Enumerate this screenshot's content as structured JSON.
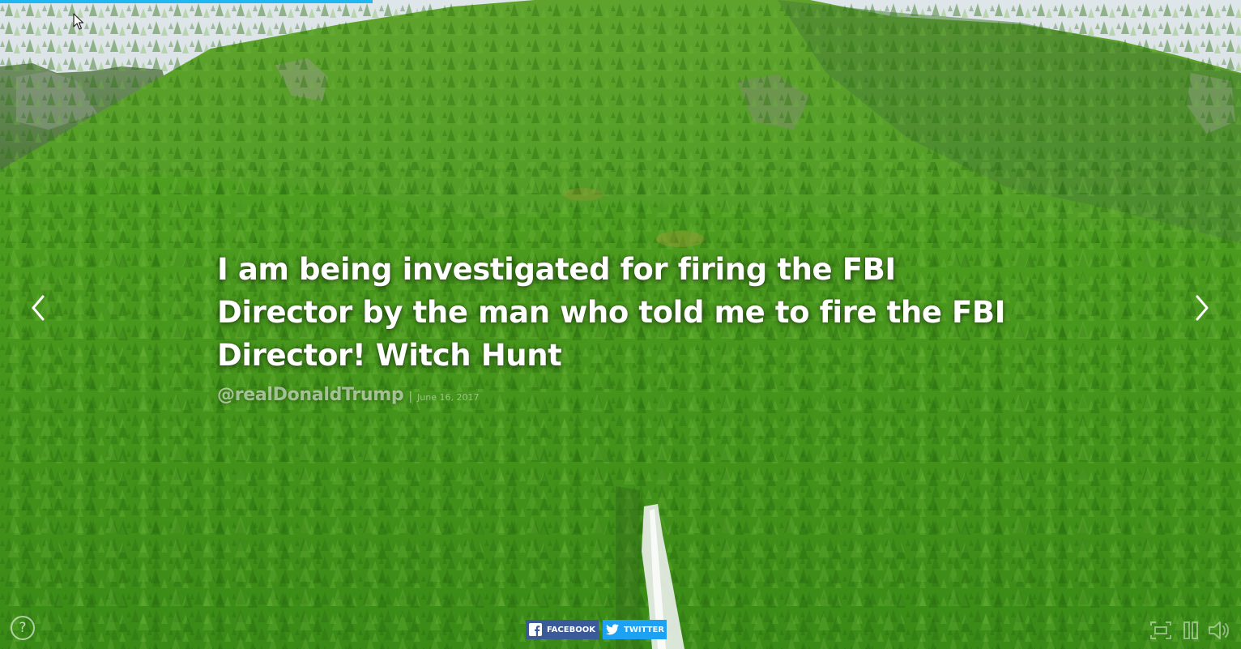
{
  "slide": {
    "quote": "I am being investigated for firing the FBI Director by the man who told me to fire the FBI Director! Witch Hunt",
    "handle": "@realDonaldTrump",
    "separator": "|",
    "date": "June 16, 2017"
  },
  "progress": {
    "fraction": 0.3
  },
  "share": {
    "facebook_label": "FACEBOOK",
    "twitter_label": "TWITTER"
  },
  "help": {
    "label": "?"
  },
  "icons": {
    "prev": "chevron-left-icon",
    "next": "chevron-right-icon",
    "help": "question-circle-icon",
    "facebook": "facebook-icon",
    "twitter": "twitter-icon",
    "fullscreen": "fullscreen-icon",
    "pause": "pause-icon",
    "volume": "volume-icon"
  },
  "colors": {
    "progress": "#1fb8f2",
    "facebook": "#3b5a98",
    "twitter": "#1da1f2",
    "quote_text": "#ffffff"
  }
}
